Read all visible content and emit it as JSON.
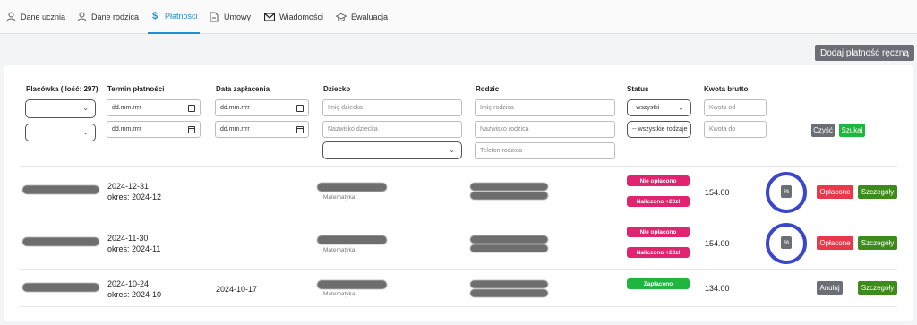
{
  "tabs": [
    {
      "label": "Dane ucznia",
      "icon": "student-icon",
      "active": false
    },
    {
      "label": "Dane rodzica",
      "icon": "parent-icon",
      "active": false
    },
    {
      "label": "Płatności",
      "icon": "dollar-icon",
      "active": true
    },
    {
      "label": "Umowy",
      "icon": "document-icon",
      "active": false
    },
    {
      "label": "Wiadomości",
      "icon": "mail-icon",
      "active": false
    },
    {
      "label": "Ewaluacja",
      "icon": "graduation-cap-icon",
      "active": false
    }
  ],
  "actions": {
    "add_manual_payment": "Dodaj płatność ręczną"
  },
  "columns": {
    "facility": "Placówka (ilość: 297)",
    "due_date": "Termin płatności",
    "payment_date": "Data zapłacenia",
    "child": "Dziecko",
    "parent": "Rodzic",
    "status": "Status",
    "gross_amount": "Kwota brutto"
  },
  "filters": {
    "date_placeholder": "dd.mm.rrrr",
    "child_first_name": "Imię dziecka",
    "child_last_name": "Nazwisko dziecka",
    "parent_name": "Imię rodzica",
    "parent_last_name": "Nazwisko rodzica",
    "parent_phone": "Telefon rodzica",
    "status_select": "- wszystki -",
    "status_select2": "-- wszystkie rodzaje",
    "amount_from": "Kwota od",
    "amount_to": "Kwota do",
    "clear": "Czyść",
    "search": "Szukaj"
  },
  "rows": [
    {
      "due_date": "2024-12-31",
      "period": "okres: 2024-12",
      "payment_date": "",
      "subject": "Matematyka",
      "status": [
        "Nie opłacono",
        "Naliczono +20zł"
      ],
      "amount": "154.00",
      "pct": "%",
      "action": "Opłacone",
      "details": "Szczegóły"
    },
    {
      "due_date": "2024-11-30",
      "period": "okres: 2024-11",
      "payment_date": "",
      "subject": "Matematyka",
      "status": [
        "Nie opłacono",
        "Naliczono +20zł"
      ],
      "amount": "154.00",
      "pct": "%",
      "action": "Opłacone",
      "details": "Szczegóły"
    },
    {
      "due_date": "2024-10-24",
      "period": "okres: 2024-10",
      "payment_date": "2024-10-17",
      "subject": "Matematyka",
      "status": [
        "Zapłacono"
      ],
      "amount": "134.00",
      "pct": "",
      "action": "Anuluj",
      "details": "Szczegóły"
    }
  ],
  "colors": {
    "accent": "#1f8dd6",
    "pink": "#e0246f",
    "green": "#1fb53f",
    "red": "#e8384a",
    "olive": "#3e8a1c",
    "gray": "#6b6f75",
    "ring": "#3b47c9"
  }
}
